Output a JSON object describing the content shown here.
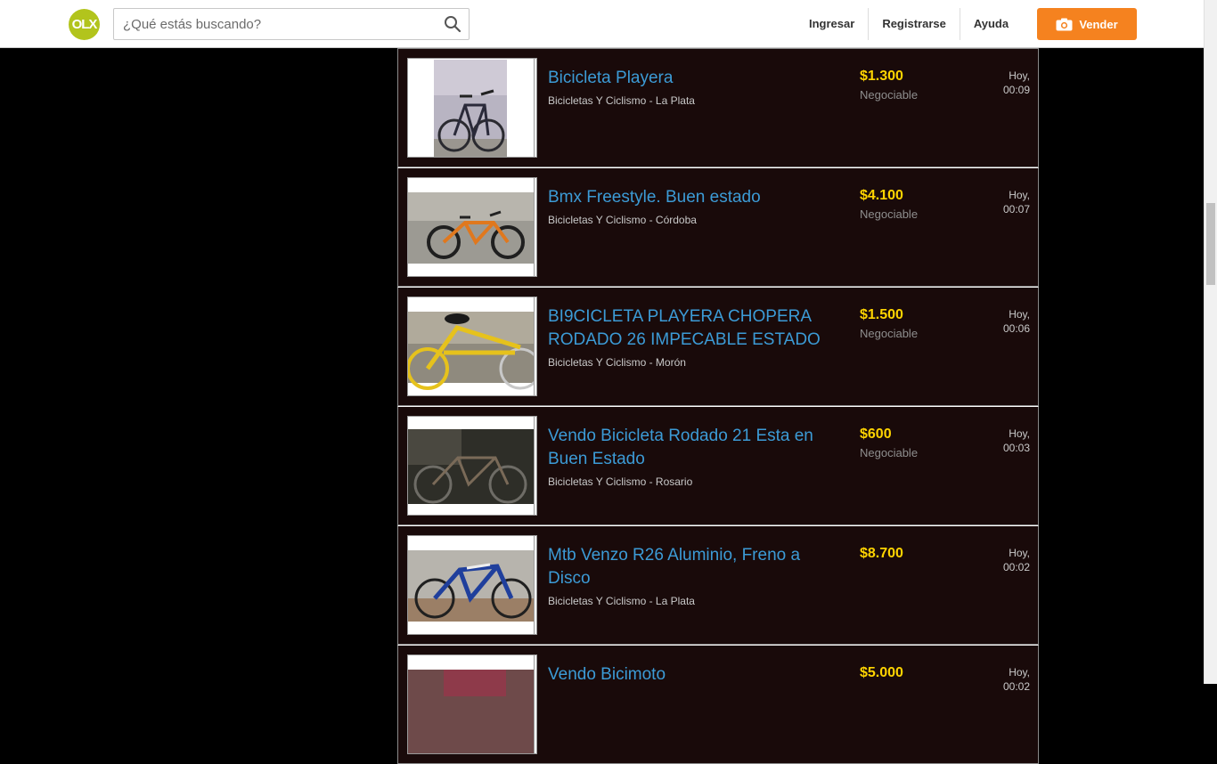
{
  "header": {
    "logo_text": "OLX",
    "search_placeholder": "¿Qué estás buscando?",
    "nav": [
      "Ingresar",
      "Registrarse",
      "Ayuda"
    ],
    "sell_label": "Vender",
    "colors": {
      "brand": "#b2c41c",
      "accent": "#f5821f",
      "title": "#3c9bd6",
      "price": "#ffd400"
    }
  },
  "listings": [
    {
      "title": "Bicicleta Playera",
      "category": "Bicicletas Y Ciclismo - La Plata",
      "price": "$1.300",
      "negotiable": "Negociable",
      "date_day": "Hoy,",
      "date_time": "00:09",
      "image": "beach-bicycle-photo"
    },
    {
      "title": "Bmx Freestyle. Buen estado",
      "category": "Bicicletas Y Ciclismo - Córdoba",
      "price": "$4.100",
      "negotiable": "Negociable",
      "date_day": "Hoy,",
      "date_time": "00:07",
      "image": "orange-bmx-photo"
    },
    {
      "title": "BI9CICLETA PLAYERA CHOPERA RODADO 26 IMPECABLE ESTADO",
      "category": "Bicicletas Y Ciclismo - Morón",
      "price": "$1.500",
      "negotiable": "Negociable",
      "date_day": "Hoy,",
      "date_time": "00:06",
      "image": "yellow-chopper-photo"
    },
    {
      "title": "Vendo Bicicleta Rodado 21 Esta en Buen Estado",
      "category": "Bicicletas Y Ciclismo - Rosario",
      "price": "$600",
      "negotiable": "Negociable",
      "date_day": "Hoy,",
      "date_time": "00:03",
      "image": "dark-bicycle-photo"
    },
    {
      "title": "Mtb Venzo R26 Aluminio, Freno a Disco",
      "category": "Bicicletas Y Ciclismo - La Plata",
      "price": "$8.700",
      "negotiable": "",
      "date_day": "Hoy,",
      "date_time": "00:02",
      "image": "mountain-bike-photo"
    },
    {
      "title": "Vendo Bicimoto",
      "category": "",
      "price": "$5.000",
      "negotiable": "",
      "date_day": "Hoy,",
      "date_time": "00:02",
      "image": "bicimoto-photo"
    }
  ]
}
